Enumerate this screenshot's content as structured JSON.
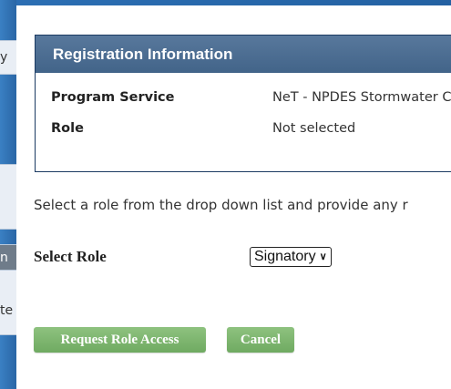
{
  "left_peek": [
    "y",
    "",
    "n",
    "te"
  ],
  "panel": {
    "title": "Registration Information",
    "rows": [
      {
        "label": "Program Service",
        "value": "NeT - NPDES Stormwater C"
      },
      {
        "label": "Role",
        "value": "Not selected"
      }
    ]
  },
  "instruction": "Select a role from the drop down list and provide any r",
  "select_role": {
    "label": "Select Role",
    "selected": "Signatory"
  },
  "buttons": {
    "request_label": "Request Role Access",
    "cancel_label": "Cancel"
  },
  "colors": {
    "header": "#4a6d93",
    "button_green": "#7bb56c",
    "background_blue": "#1f5a99"
  }
}
